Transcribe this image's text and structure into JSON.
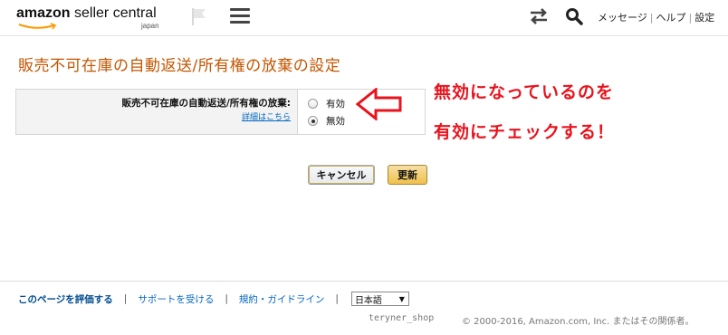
{
  "header": {
    "logo_amazon": "amazon",
    "logo_rest": " seller central",
    "logo_sub": "japan",
    "links": [
      "メッセージ",
      "ヘルプ",
      "設定"
    ]
  },
  "page": {
    "title": "販売不可在庫の自動返送/所有権の放棄の設定"
  },
  "setting": {
    "label": "販売不可在庫の自動返送/所有権の放棄:",
    "details_link": "詳細はこちら",
    "options": [
      {
        "label": "有効",
        "checked": false
      },
      {
        "label": "無効",
        "checked": true
      }
    ]
  },
  "annotation": {
    "line1": "無効になっているのを",
    "line2": "有効にチェックする！",
    "color": "#e8131d"
  },
  "buttons": {
    "cancel": "キャンセル",
    "update": "更新"
  },
  "footer": {
    "rate_page": "このページを評価する",
    "support": "サポートを受ける",
    "policies": "規約・ガイドライン",
    "language": "日本語",
    "shop_name": "teryner_shop",
    "copyright": "© 2000-2016, Amazon.com, Inc. またはその関係者。"
  },
  "colors": {
    "title": "#c45500",
    "link": "#0066c0",
    "update_button": "#f0c14b"
  }
}
